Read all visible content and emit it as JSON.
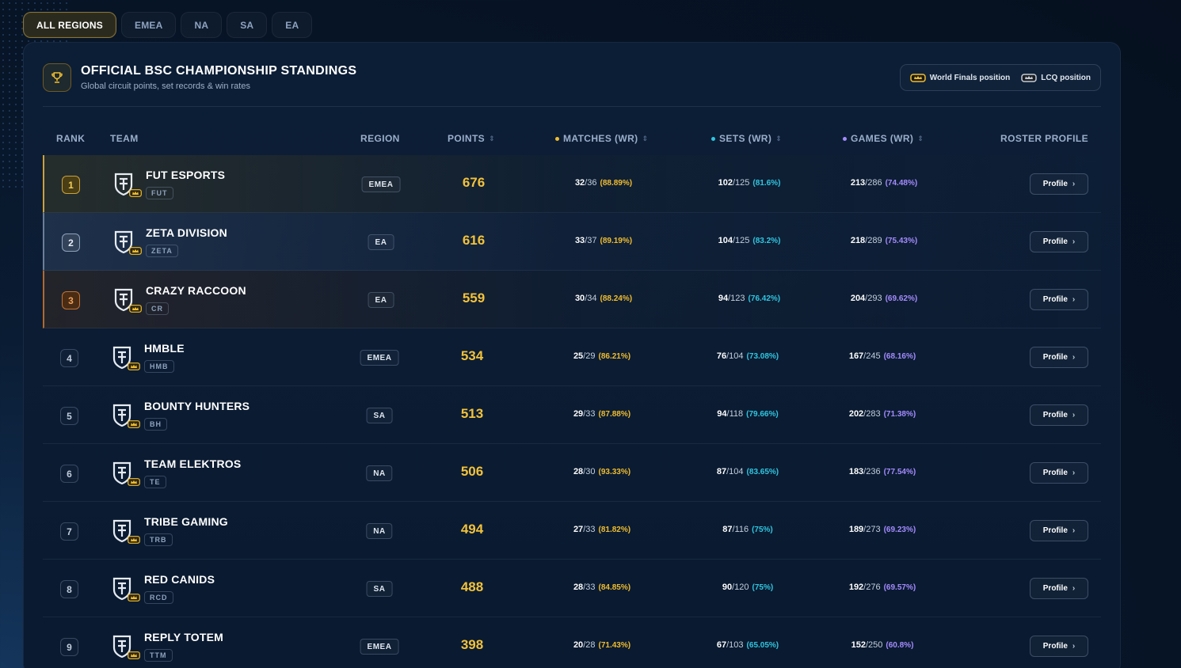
{
  "region_tabs": [
    {
      "label": "ALL REGIONS",
      "active": true
    },
    {
      "label": "EMEA"
    },
    {
      "label": "NA"
    },
    {
      "label": "SA"
    },
    {
      "label": "EA"
    }
  ],
  "header": {
    "title": "OFFICIAL BSC CHAMPIONSHIP STANDINGS",
    "subtitle": "Global circuit points, set records & win rates",
    "icon": "trophy-icon"
  },
  "legend": {
    "world_finals": "World Finals position",
    "lcq": "LCQ position"
  },
  "columns": {
    "rank": "RANK",
    "team": "TEAM",
    "region": "REGION",
    "points": "POINTS",
    "matches": "MATCHES (WR)",
    "sets": "SETS (WR)",
    "games": "GAMES (WR)",
    "roster": "ROSTER PROFILE"
  },
  "colors": {
    "gold": "#f0bd2f",
    "cyan": "#2fc6e0",
    "purple": "#a48bff"
  },
  "rows": [
    {
      "rank": "1",
      "name": "FUT ESPORTS",
      "abbr": "FUT",
      "region": "EMEA",
      "points": "676",
      "m_w": "32",
      "m_t": "/36",
      "m_p": "(88.89%)",
      "s_w": "102",
      "s_t": "/125",
      "s_p": "(81.6%)",
      "g_w": "213",
      "g_t": "/286",
      "g_p": "(74.48%)",
      "profile": "Profile"
    },
    {
      "rank": "2",
      "name": "ZETA DIVISION",
      "abbr": "ZETA",
      "region": "EA",
      "points": "616",
      "m_w": "33",
      "m_t": "/37",
      "m_p": "(89.19%)",
      "s_w": "104",
      "s_t": "/125",
      "s_p": "(83.2%)",
      "g_w": "218",
      "g_t": "/289",
      "g_p": "(75.43%)",
      "profile": "Profile"
    },
    {
      "rank": "3",
      "name": "CRAZY RACCOON",
      "abbr": "CR",
      "region": "EA",
      "points": "559",
      "m_w": "30",
      "m_t": "/34",
      "m_p": "(88.24%)",
      "s_w": "94",
      "s_t": "/123",
      "s_p": "(76.42%)",
      "g_w": "204",
      "g_t": "/293",
      "g_p": "(69.62%)",
      "profile": "Profile"
    },
    {
      "rank": "4",
      "name": "HMBLE",
      "abbr": "HMB",
      "region": "EMEA",
      "points": "534",
      "m_w": "25",
      "m_t": "/29",
      "m_p": "(86.21%)",
      "s_w": "76",
      "s_t": "/104",
      "s_p": "(73.08%)",
      "g_w": "167",
      "g_t": "/245",
      "g_p": "(68.16%)",
      "profile": "Profile"
    },
    {
      "rank": "5",
      "name": "BOUNTY HUNTERS",
      "abbr": "BH",
      "region": "SA",
      "points": "513",
      "m_w": "29",
      "m_t": "/33",
      "m_p": "(87.88%)",
      "s_w": "94",
      "s_t": "/118",
      "s_p": "(79.66%)",
      "g_w": "202",
      "g_t": "/283",
      "g_p": "(71.38%)",
      "profile": "Profile"
    },
    {
      "rank": "6",
      "name": "TEAM ELEKTROS",
      "abbr": "TE",
      "region": "NA",
      "points": "506",
      "m_w": "28",
      "m_t": "/30",
      "m_p": "(93.33%)",
      "s_w": "87",
      "s_t": "/104",
      "s_p": "(83.65%)",
      "g_w": "183",
      "g_t": "/236",
      "g_p": "(77.54%)",
      "profile": "Profile"
    },
    {
      "rank": "7",
      "name": "TRIBE GAMING",
      "abbr": "TRB",
      "region": "NA",
      "points": "494",
      "m_w": "27",
      "m_t": "/33",
      "m_p": "(81.82%)",
      "s_w": "87",
      "s_t": "/116",
      "s_p": "(75%)",
      "g_w": "189",
      "g_t": "/273",
      "g_p": "(69.23%)",
      "profile": "Profile"
    },
    {
      "rank": "8",
      "name": "RED CANIDS",
      "abbr": "RCD",
      "region": "SA",
      "points": "488",
      "m_w": "28",
      "m_t": "/33",
      "m_p": "(84.85%)",
      "s_w": "90",
      "s_t": "/120",
      "s_p": "(75%)",
      "g_w": "192",
      "g_t": "/276",
      "g_p": "(69.57%)",
      "profile": "Profile"
    },
    {
      "rank": "9",
      "name": "REPLY TOTEM",
      "abbr": "TTM",
      "region": "EMEA",
      "points": "398",
      "m_w": "20",
      "m_t": "/28",
      "m_p": "(71.43%)",
      "s_w": "67",
      "s_t": "/103",
      "s_p": "(65.05%)",
      "g_w": "152",
      "g_t": "/250",
      "g_p": "(60.8%)",
      "profile": "Profile"
    }
  ]
}
